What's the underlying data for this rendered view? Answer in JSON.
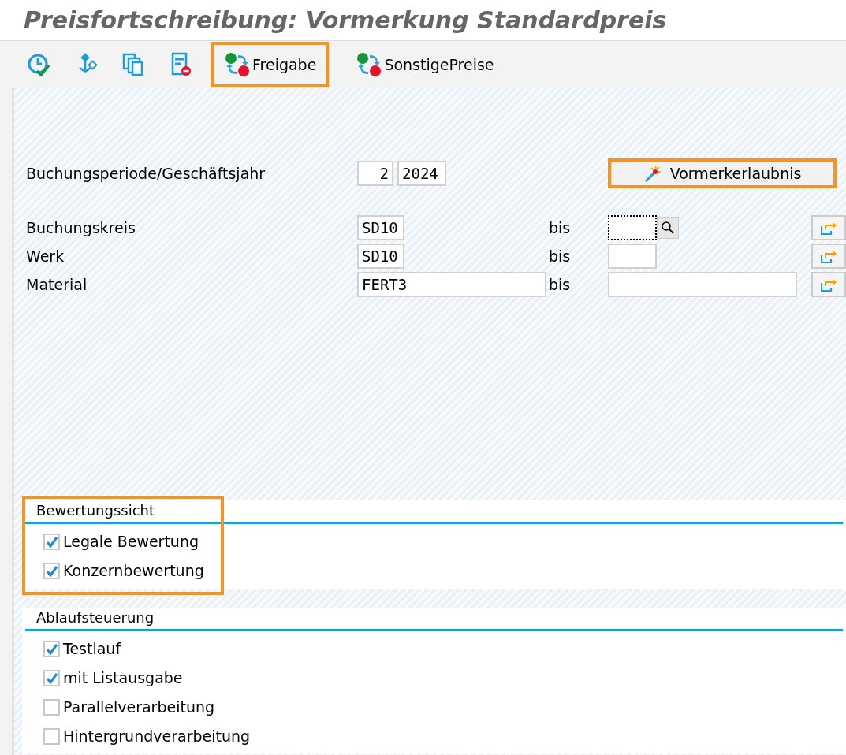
{
  "window": {
    "title": "Preisfortschreibung: Vormerkung Standardpreis"
  },
  "toolbar": {
    "buttons": [
      {
        "label": "Freigabe",
        "highlighted": true
      },
      {
        "label": "SonstigePreise",
        "highlighted": false
      }
    ]
  },
  "period": {
    "label": "Buchungsperiode/Geschäftsjahr",
    "values": [
      "2",
      "2024"
    ],
    "button": {
      "label": "Vormerkerlaubnis",
      "highlighted": true
    }
  },
  "selections": [
    {
      "label": "Buchungskreis",
      "kind": "short",
      "from": "SD10",
      "separator": "bis",
      "focused": true
    },
    {
      "label": "Werk",
      "kind": "short",
      "from": "SD10",
      "separator": "bis",
      "focused": false
    },
    {
      "label": "Material",
      "kind": "long",
      "from": "FERT3",
      "separator": "bis",
      "focused": false
    }
  ],
  "sections": [
    {
      "title": "Bewertungssicht",
      "highlighted": true,
      "options": [
        {
          "label": "Legale Bewertung",
          "checked": true
        },
        {
          "label": "Konzernbewertung",
          "checked": true
        }
      ]
    },
    {
      "title": "Ablaufsteuerung",
      "highlighted": false,
      "options": [
        {
          "label": "Testlauf",
          "checked": true
        },
        {
          "label": "mit Listausgabe",
          "checked": true
        },
        {
          "label": "Parallelverarbeitung",
          "checked": false
        },
        {
          "label": "Hintergrundverarbeitung",
          "checked": false
        }
      ]
    }
  ]
}
